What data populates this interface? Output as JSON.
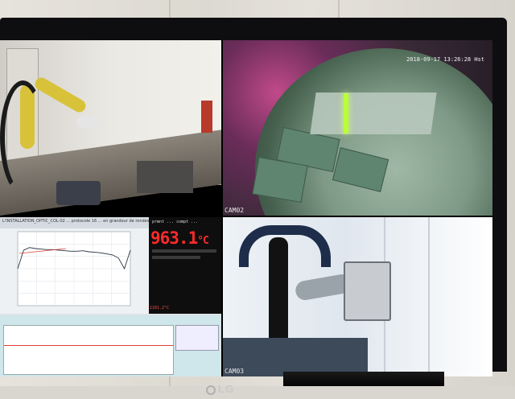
{
  "cam02": {
    "timestamp": "2018-09-17 13:26:28 Hst",
    "label": "CAM02"
  },
  "cam03": {
    "label": "CAM03"
  },
  "data_panel": {
    "window_title": "L'INSTALLATION_OPTIC_COL-02 ... protocole 16 ... en grandeur de rondes ...",
    "readout_tabs": "prmnt ... compt ...",
    "temperature": "963.1",
    "temperature_unit": "°C",
    "footer_value": "1161.2°C"
  },
  "monitor": {
    "brand": "LG"
  },
  "chart_data": {
    "type": "line",
    "series": [
      {
        "values": [
          1150,
          1185,
          1190,
          1188,
          1187,
          1186,
          1186,
          1185,
          1184,
          1183,
          1183,
          1184,
          1182,
          1181,
          1180,
          1178,
          1176,
          1170,
          1150,
          1185
        ]
      }
    ]
  }
}
